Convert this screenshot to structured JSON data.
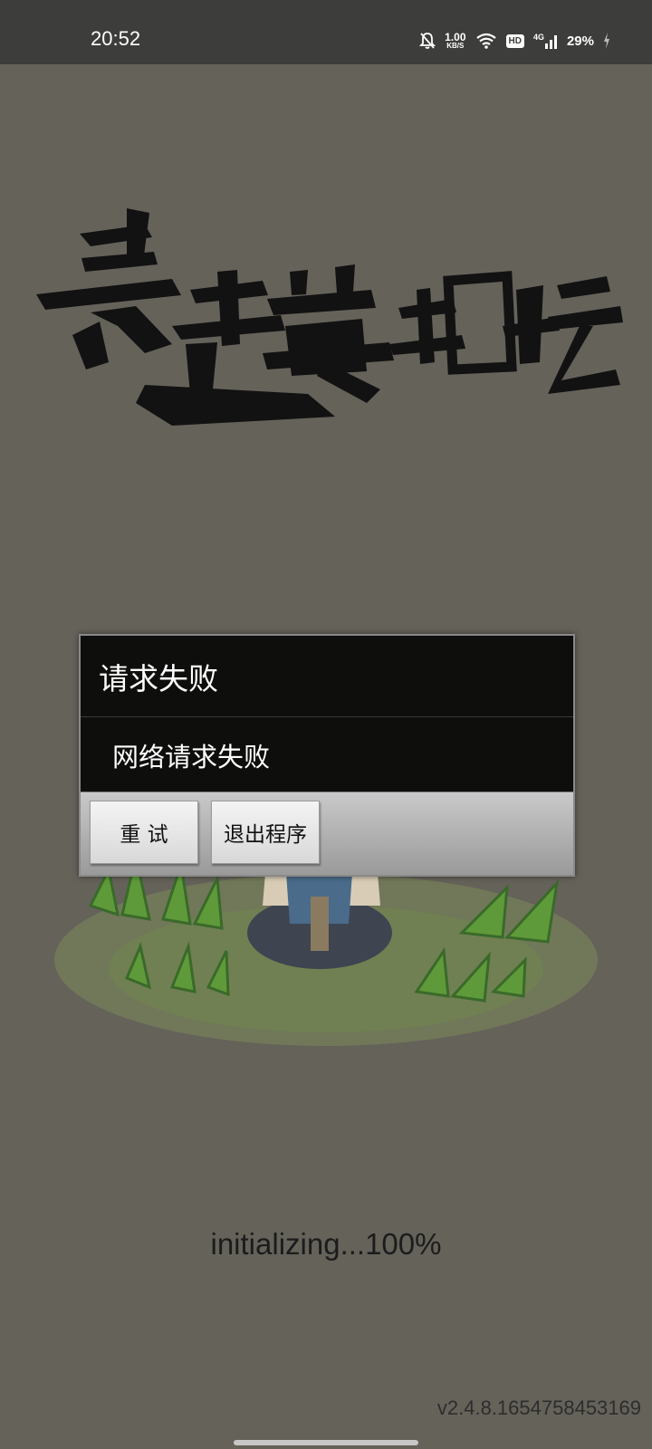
{
  "status_bar": {
    "time": "20:52",
    "net_speed_value": "1.00",
    "net_speed_unit": "KB/S",
    "hd_badge": "HD",
    "signal_label": "4G",
    "battery": "29%",
    "icons": [
      "bell-off-icon",
      "wifi-icon",
      "signal-icon",
      "charging-icon"
    ]
  },
  "logo": {
    "text": "暴走英雄坛"
  },
  "dialog": {
    "title": "请求失败",
    "message": "网络请求失败",
    "buttons": {
      "retry": "重 试",
      "exit": "退出程序"
    }
  },
  "loading": {
    "text": "initializing...100%",
    "progress": 1.0
  },
  "version": "v2.4.8.1654758453169",
  "colors": {
    "background": "#65625a",
    "status_bar": "#3d3d3b",
    "dialog_bg": "#0a0a0a",
    "button_area": "#b5b5b5"
  }
}
